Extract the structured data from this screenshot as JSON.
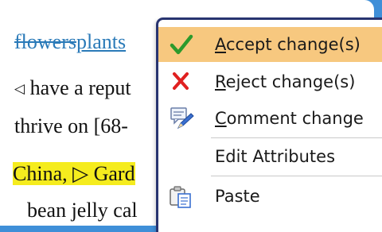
{
  "document": {
    "deleted_word": "flowers",
    "inserted_word": "plants",
    "line2_marker": "◁",
    "line2_text": " have a reput",
    "line3_text": "thrive on [68-",
    "line4_highlight": "China, ▷ Gard",
    "line5_text": "bean jelly cal",
    "highlight_color": "#f5ec1e",
    "tracked_change_color": "#2a7ab8"
  },
  "context_menu": {
    "items": [
      {
        "icon": "checkmark-icon",
        "mnemonic": "A",
        "rest": "ccept change(s)"
      },
      {
        "icon": "reject-x-icon",
        "mnemonic": "R",
        "rest": "eject change(s)"
      },
      {
        "icon": "comment-pen-icon",
        "mnemonic": "C",
        "rest": "omment change"
      },
      {
        "label": "Edit Attributes"
      },
      {
        "icon": "paste-icon",
        "label": "Paste"
      }
    ],
    "active_color": "#f7c87f",
    "border_color": "#283470"
  }
}
